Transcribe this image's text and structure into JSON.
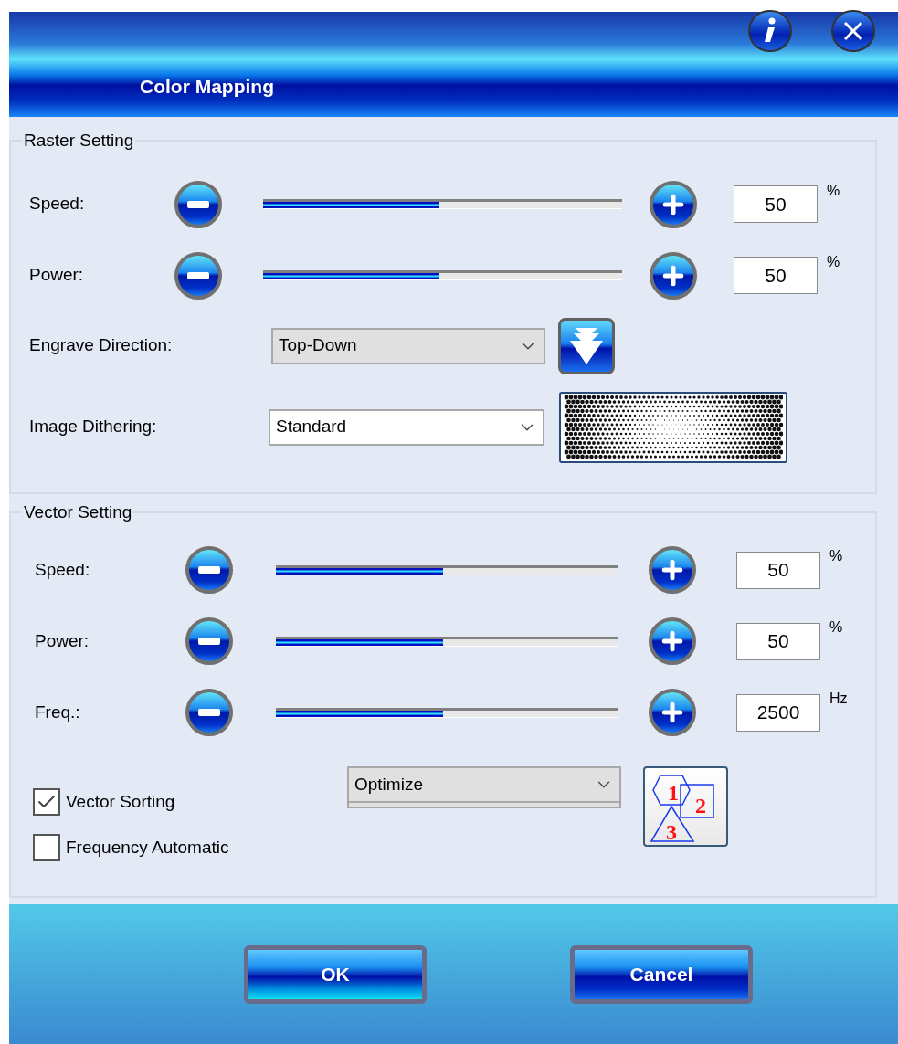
{
  "window": {
    "title": "Color Mapping"
  },
  "raster_setting": {
    "title": "Raster Setting",
    "sliders": [
      {
        "label": "Speed:",
        "level": 0.49,
        "value": "50",
        "unit": "%"
      },
      {
        "label": "Power:",
        "level": 0.49,
        "value": "50",
        "unit": "%"
      }
    ],
    "engrave_direction": {
      "label": "Engrave Direction:",
      "value": "Top-Down",
      "disabled": true
    },
    "image_dithering": {
      "label": "Image Dithering:",
      "value": "Standard",
      "disabled": false
    }
  },
  "vector_setting": {
    "title": "Vector Setting",
    "sliders": [
      {
        "label": "Speed:",
        "level": 0.49,
        "value": "50",
        "unit": "%"
      },
      {
        "label": "Power:",
        "level": 0.49,
        "value": "50",
        "unit": "%"
      },
      {
        "label": "Freq.:",
        "level": 0.49,
        "value": "2500",
        "unit": "Hz"
      }
    ],
    "options": [
      {
        "label": "Vector Sorting",
        "checked": true
      },
      {
        "label": "Frequency Automatic",
        "checked": false
      }
    ],
    "sorting_method": {
      "value": "Optimize",
      "disabled": true,
      "icon_digits": [
        "1",
        "2",
        "3"
      ]
    }
  },
  "buttons": [
    {
      "label": "OK",
      "kind": "ok"
    },
    {
      "label": "Cancel",
      "kind": "cancel"
    }
  ]
}
